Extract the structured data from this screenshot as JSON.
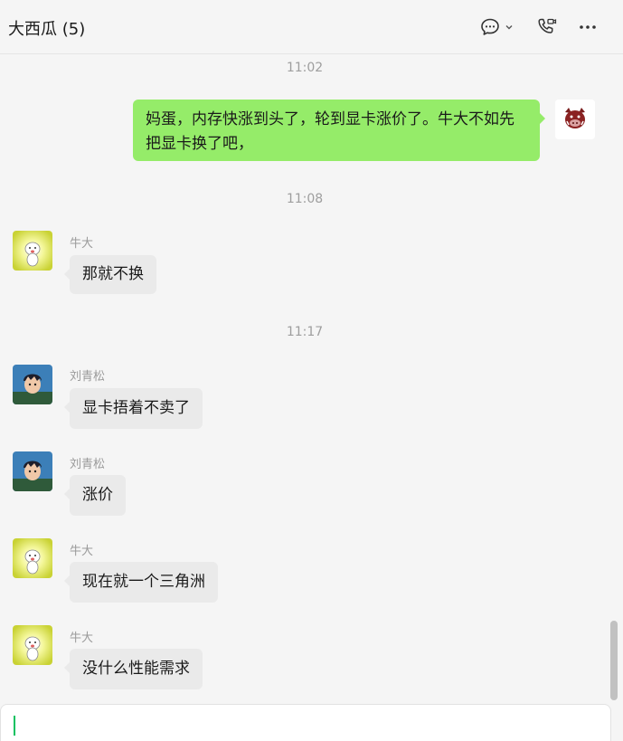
{
  "header": {
    "title": "大西瓜 (5)"
  },
  "messages": [
    {
      "type": "time",
      "text": "11:02"
    },
    {
      "type": "outgoing",
      "text_line1": "妈蛋，内存快涨到头了，轮到显卡涨价了。牛大不如先",
      "text_line2": "把显卡换了吧，"
    },
    {
      "type": "time",
      "text": "11:08"
    },
    {
      "type": "incoming",
      "sender": "牛大",
      "text": "那就不换"
    },
    {
      "type": "time",
      "text": "11:17"
    },
    {
      "type": "incoming",
      "sender": "刘青松",
      "text": "显卡捂着不卖了"
    },
    {
      "type": "incoming",
      "sender": "刘青松",
      "text": "涨价"
    },
    {
      "type": "incoming",
      "sender": "牛大",
      "text": "现在就一个三角洲"
    },
    {
      "type": "incoming",
      "sender": "牛大",
      "text": "没什么性能需求"
    }
  ],
  "colors": {
    "outgoing_bubble": "#95ec69",
    "incoming_bubble": "#eaeaea",
    "caret": "#07c160"
  },
  "icons": {
    "chat_options": "chat-bubble-icon",
    "call": "phone-video-icon",
    "more": "more-dots-icon"
  }
}
